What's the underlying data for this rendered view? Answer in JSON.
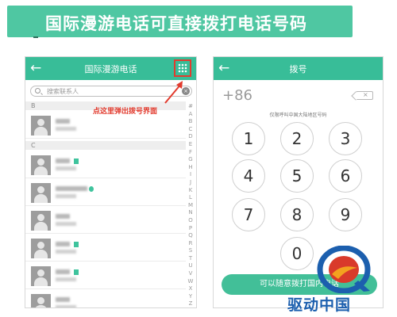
{
  "banner": {
    "text": "国际漫游电话可直接拨打电话号码"
  },
  "contacts_screen": {
    "title": "国际漫游电话",
    "back_icon": "arrow-left-icon",
    "grid_icon": "dialpad-grid-icon",
    "search_placeholder": "搜索联系人",
    "hint": "点这里弹出拨号界面",
    "sections": [
      "B",
      "C"
    ],
    "index_letters": [
      "#",
      "A",
      "B",
      "C",
      "D",
      "E",
      "F",
      "G",
      "H",
      "I",
      "J",
      "K",
      "L",
      "M",
      "N",
      "O",
      "P",
      "Q",
      "R",
      "S",
      "T",
      "U",
      "V",
      "W",
      "X",
      "Y",
      "Z"
    ]
  },
  "dialer_screen": {
    "title": "拨号",
    "back_icon": "arrow-left-icon",
    "prefix": "+86",
    "hint": "仅限呼叫中国大陆地区号码",
    "keys": [
      "1",
      "2",
      "3",
      "4",
      "5",
      "6",
      "7",
      "8",
      "9",
      "0"
    ],
    "call_button": "可以随意拨打国内电话"
  },
  "watermark": {
    "text": "驱动中国"
  },
  "colors": {
    "accent": "#38bd98",
    "highlight": "#e23b2e",
    "logo": "#1c5fae"
  }
}
